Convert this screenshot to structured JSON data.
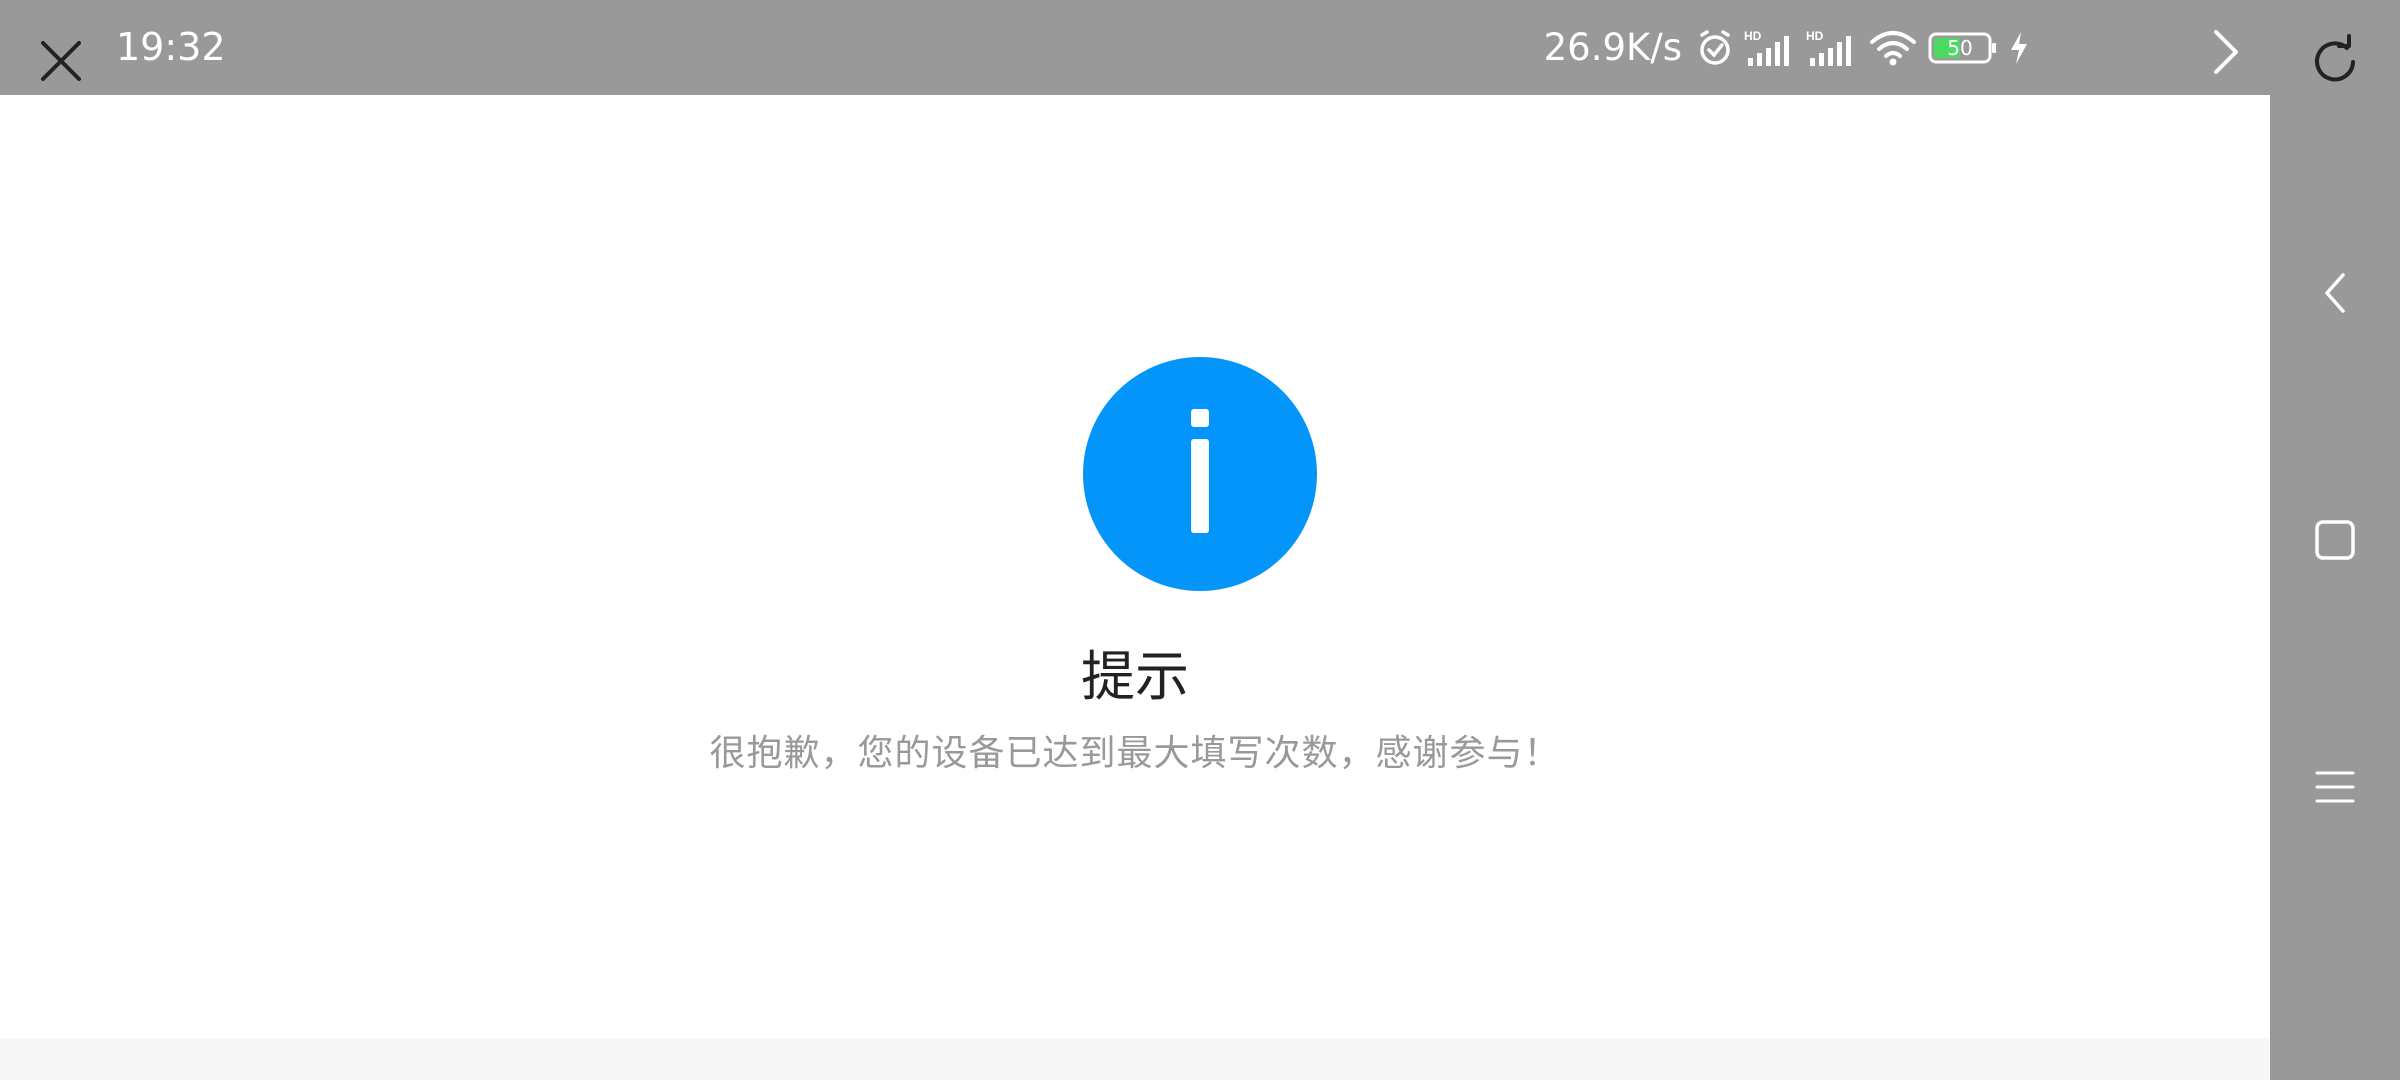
{
  "status_bar": {
    "time": "19:32",
    "net_speed": "26.9K/s",
    "battery": "50",
    "icons": [
      "alarm-icon",
      "hd-signal-icon",
      "hd-signal-icon",
      "wifi-icon",
      "battery-icon",
      "charging-icon"
    ]
  },
  "browser": {
    "close_icon": "close-icon",
    "back_icon": "chevron-left-icon",
    "forward_icon": "chevron-right-icon",
    "reload_icon": "reload-icon"
  },
  "nav_bar": {
    "icons": [
      "back-icon",
      "home-icon",
      "menu-icon"
    ]
  },
  "content": {
    "title": "提示",
    "message": "很抱歉，您的设备已达到最大填写次数，感谢参与！"
  },
  "colors": {
    "bar_gray": "#999999",
    "info_blue": "#0495fb",
    "battery_green": "#4cd964",
    "title_text": "#222222",
    "message_text": "#999999"
  }
}
